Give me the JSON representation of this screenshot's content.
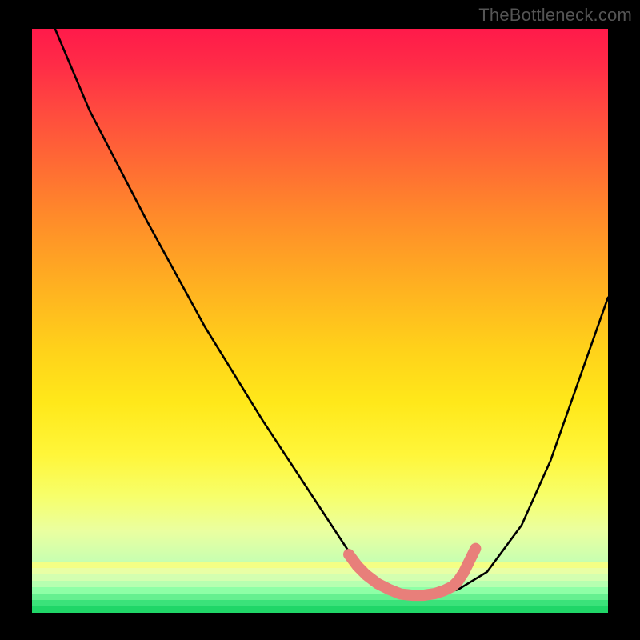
{
  "watermark": "TheBottleneck.com",
  "chart_data": {
    "type": "line",
    "title": "",
    "xlabel": "",
    "ylabel": "",
    "xlim": [
      0,
      100
    ],
    "ylim": [
      0,
      100
    ],
    "grid": false,
    "series": [
      {
        "name": "curve",
        "color": "#000000",
        "x": [
          4,
          10,
          20,
          30,
          40,
          50,
          56,
          60,
          65,
          70,
          74,
          79,
          85,
          90,
          95,
          100
        ],
        "y": [
          100,
          86,
          67,
          49,
          33,
          18,
          9,
          5,
          3,
          3,
          4,
          7,
          15,
          26,
          40,
          54
        ]
      },
      {
        "name": "valley-highlight",
        "color": "#e87f7a",
        "x": [
          55,
          56.5,
          58,
          60,
          62,
          64,
          66,
          68,
          70,
          71.5,
          73,
          74,
          75,
          76,
          77
        ],
        "y": [
          10,
          8,
          6.5,
          5,
          4,
          3.2,
          3,
          3,
          3.3,
          3.8,
          4.5,
          5.5,
          7,
          9,
          11
        ]
      }
    ],
    "background_gradient_stops_pct": [
      0,
      6,
      14,
      23,
      32,
      42,
      55,
      64,
      73,
      80,
      86,
      91,
      95,
      100
    ],
    "background_gradient_colors": [
      "#ff1a4a",
      "#ff2b47",
      "#ff4a3f",
      "#ff6a34",
      "#ff8a2a",
      "#ffaa22",
      "#ffd21a",
      "#ffe81a",
      "#fff63a",
      "#f7ff6a",
      "#eaffa0",
      "#c9ffb0",
      "#7fffa0",
      "#28e56a"
    ],
    "bottom_band_colors": [
      "#f4ff85",
      "#e9ffa5",
      "#d4ffb0",
      "#b6ffb0",
      "#8effa6",
      "#66f090",
      "#3be27a",
      "#20d668"
    ]
  }
}
